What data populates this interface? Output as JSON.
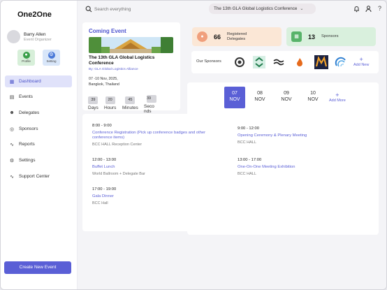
{
  "app": {
    "name": "One2One"
  },
  "user": {
    "name": "Barry Allen",
    "role": "Event Organizer"
  },
  "quick_actions": [
    {
      "label": "Profile",
      "icon": "user-icon"
    },
    {
      "label": "Setting",
      "icon": "gear-icon"
    }
  ],
  "nav": [
    {
      "label": "Dashboard",
      "icon": "dashboard-icon",
      "active": true
    },
    {
      "label": "Events",
      "icon": "calendar-icon"
    },
    {
      "label": "Delegates",
      "icon": "users-icon"
    },
    {
      "label": "Sponsors",
      "icon": "globe-icon"
    },
    {
      "label": "Reports",
      "icon": "activity-icon"
    },
    {
      "label": "Settings",
      "icon": "gear-icon"
    },
    {
      "label": "Support Center",
      "icon": "pulse-icon"
    }
  ],
  "create_button": "Create New Event",
  "search": {
    "placeholder": "Search everything"
  },
  "event_select": {
    "value": "The 13th GLA Global Logistics Conference"
  },
  "header_icons": [
    "bell-icon",
    "user-icon",
    "help-icon"
  ],
  "coming_event": {
    "heading": "Coming Event",
    "name": "The 13th GLA Global Logistics Conference",
    "by": "By: GLA Global Logistics Alliance",
    "dates": "07 -10 Nov, 2025,",
    "location": "Bangkok, Thailand",
    "countdown": [
      {
        "value": "39",
        "label": "Days"
      },
      {
        "value": "20",
        "label": "Hours"
      },
      {
        "value": "45",
        "label": "Minutes"
      },
      {
        "value": "39",
        "label": "Seco nds"
      }
    ]
  },
  "stats": {
    "delegates": {
      "value": "66",
      "label": "Registered Delegates"
    },
    "sponsors": {
      "value": "13",
      "label": "Sponsors"
    }
  },
  "sponsors": {
    "label": "Our Sponsors",
    "logos": [
      "spiral-logo",
      "green-arrows-logo",
      "wave-logo",
      "flame-logo",
      "m-logo",
      "swirl-logo"
    ],
    "add_label": "Add New"
  },
  "dates": [
    {
      "day": "07",
      "month": "NOV",
      "active": true
    },
    {
      "day": "08",
      "month": "NOV"
    },
    {
      "day": "09",
      "month": "NOV"
    },
    {
      "day": "10",
      "month": "NOV"
    }
  ],
  "add_more": "Add More",
  "schedule_left": [
    {
      "time": "8:00 - 9:00",
      "title": "Conference Registration (Pick up conference badges and other conference items)",
      "venue": "BCC HALL Reception Center"
    },
    {
      "time": "12:00 - 13:00",
      "title": "Buffet Lunch",
      "venue": "World Ballroom + Delegate Bar"
    },
    {
      "time": "17:00 - 19:00",
      "title": "Gala Dinner",
      "venue": "BCC Hall"
    }
  ],
  "schedule_right": [
    {
      "time": "9:00 - 12:00",
      "title": "Opening Ceremony & Plenary Meeting",
      "venue": "BCC HALL"
    },
    {
      "time": "13:00 - 17:00",
      "title": "One-On-One Meeting Exhibition",
      "venue": "BCC HALL"
    }
  ]
}
